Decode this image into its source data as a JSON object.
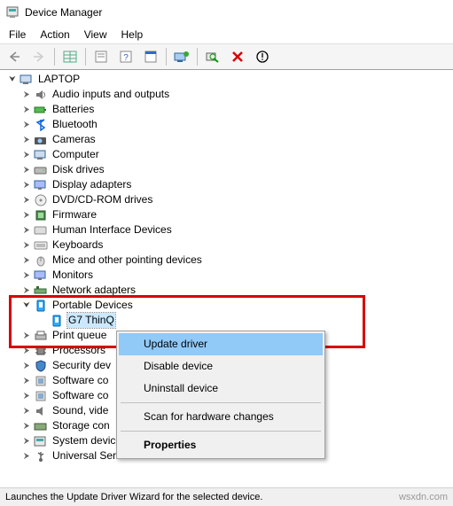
{
  "window": {
    "title": "Device Manager"
  },
  "menu": {
    "file": "File",
    "action": "Action",
    "view": "View",
    "help": "Help"
  },
  "root": "LAPTOP",
  "categories": [
    "Audio inputs and outputs",
    "Batteries",
    "Bluetooth",
    "Cameras",
    "Computer",
    "Disk drives",
    "Display adapters",
    "DVD/CD-ROM drives",
    "Firmware",
    "Human Interface Devices",
    "Keyboards",
    "Mice and other pointing devices",
    "Monitors",
    "Network adapters"
  ],
  "portable": {
    "category": "Portable Devices",
    "device": "G7 ThinQ"
  },
  "categories_after": [
    "Print queue",
    "Processors",
    "Security dev",
    "Software co",
    "Software co",
    "Sound, vide",
    "Storage con",
    "System devices",
    "Universal Serial Bus controllers"
  ],
  "context_menu": {
    "update": "Update driver",
    "disable": "Disable device",
    "uninstall": "Uninstall device",
    "scan": "Scan for hardware changes",
    "properties": "Properties"
  },
  "status": "Launches the Update Driver Wizard for the selected device.",
  "watermark": "wsxdn.com"
}
